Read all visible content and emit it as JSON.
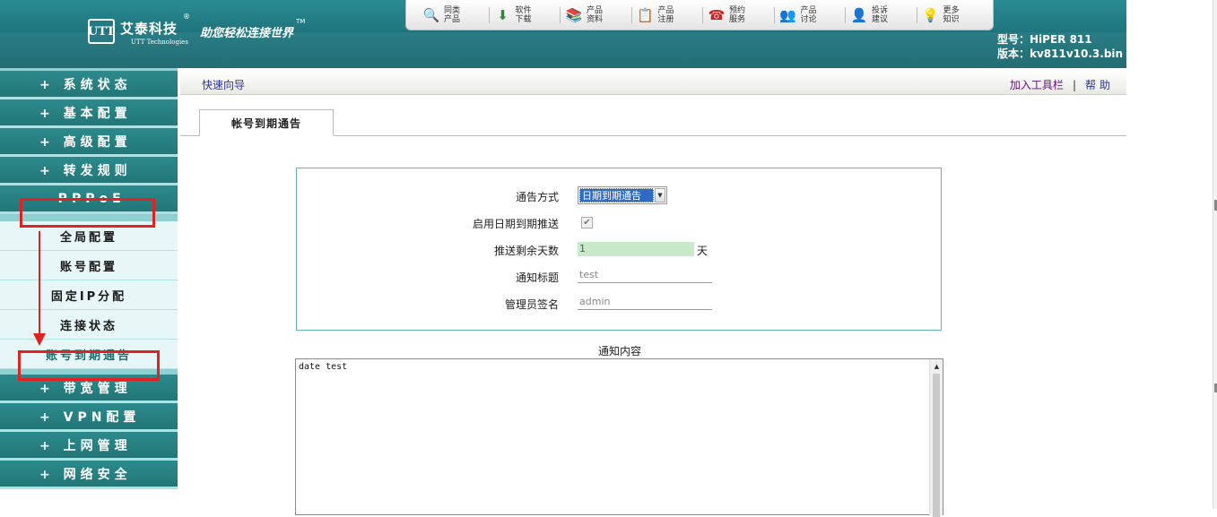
{
  "header": {
    "logo_mark": "UTT",
    "logo_cn": "艾泰科技",
    "logo_reg": "®",
    "logo_en": "UTT Technologies",
    "slogan": "助您轻松连接世界",
    "slogan_tm": "TM",
    "model_line": "型号：HiPER 811",
    "version_line": "版本：kv811v10.3.bin"
  },
  "toolbar": [
    {
      "icon": "search-icon",
      "glyph": "🔍",
      "label": "同类产品"
    },
    {
      "icon": "download-icon",
      "glyph": "⬇",
      "label": "软件下载"
    },
    {
      "icon": "books-icon",
      "glyph": "📚",
      "label": "产品资料"
    },
    {
      "icon": "clipboard-icon",
      "glyph": "📋",
      "label": "产品注册"
    },
    {
      "icon": "phone-icon",
      "glyph": "☎",
      "label": "预约服务"
    },
    {
      "icon": "users-icon",
      "glyph": "👥",
      "label": "产品讨论"
    },
    {
      "icon": "person-icon",
      "glyph": "👤",
      "label": "投诉建议"
    },
    {
      "icon": "bulb-icon",
      "glyph": "💡",
      "label": "更多知识"
    }
  ],
  "sidebar": {
    "items_top": [
      "+ 系统状态",
      "+ 基本配置",
      "+ 高级配置",
      "+ 转发规则"
    ],
    "pppoe": "- PPPoE",
    "sub_items": [
      "全局配置",
      "账号配置",
      "固定IP分配",
      "连接状态",
      "账号到期通告"
    ],
    "items_bottom": [
      "+ 带宽管理",
      "+ VPN配置",
      "+ 上网管理",
      "+ 网络安全"
    ]
  },
  "crumb": {
    "left": "快速向导",
    "add_toolbar": "加入工具栏",
    "separator": "|",
    "help": "帮助"
  },
  "tab": {
    "label": "帐号到期通告"
  },
  "form": {
    "mode_label": "通告方式",
    "mode_value": "日期到期通告",
    "enable_label": "启用日期到期推送",
    "enable_checked": "✔",
    "days_label": "推送剩余天数",
    "days_value": "1",
    "days_unit": "天",
    "title_label": "通知标题",
    "title_value": "test",
    "admin_label": "管理员签名",
    "admin_value": "admin"
  },
  "content": {
    "title": "通知内容",
    "text": "date test",
    "scroll_up": "▲"
  },
  "colors": {
    "accent": "#2a8088",
    "highlight": "#e02222",
    "days_bg": "#c7ebc9"
  }
}
